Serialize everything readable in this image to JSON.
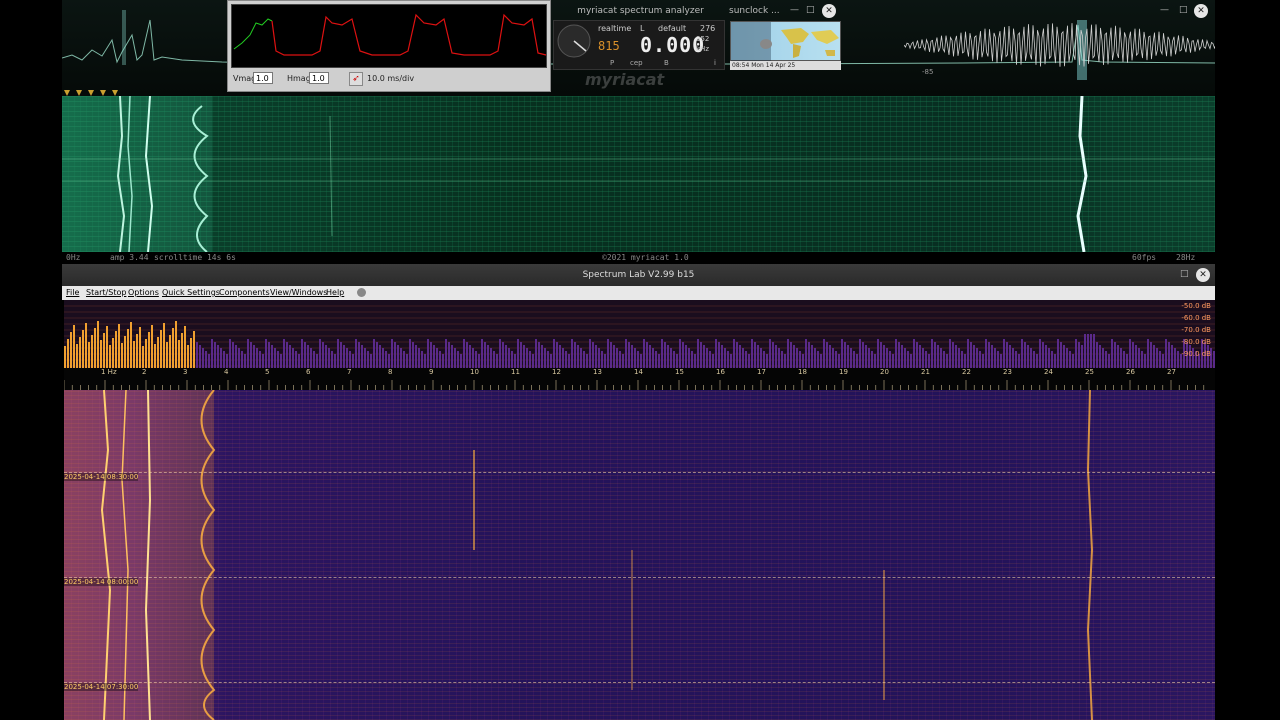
{
  "myriacat": {
    "title": "myriacat spectrum analyzer",
    "mode": "realtime",
    "channel": "L",
    "preset": "default",
    "value_a": "276",
    "value_b": "352",
    "frequency": "0.000",
    "unit": "kHz",
    "small_value": "815",
    "btn_p": "P",
    "btn_cep": "cep",
    "btn_b": "B",
    "btn_i": "i",
    "logo": "myriacat",
    "status_left": "0Hz",
    "status_amp": "amp 3.44",
    "status_scroll": "scrolltime 14s 6s",
    "status_copyright": "©2021 myriacat 1.0",
    "status_fps": "60fps",
    "status_right": "28Hz",
    "peak_label": "-85"
  },
  "scope": {
    "vmag_label": "Vmag",
    "vmag_value": "1.0",
    "hmag_label": "Hmag",
    "hmag_value": "1.0",
    "timebase": "10.0 ms/div"
  },
  "sunclock": {
    "title": "sunclock ...",
    "status": "08:54 Mon 14 Apr 25"
  },
  "spectrum_lab": {
    "title": "Spectrum Lab V2.99 b15",
    "menu": [
      "File",
      "Start/Stop",
      "Options",
      "Quick Settings",
      "Components",
      "View/Windows",
      "Help"
    ],
    "db_labels": [
      "-50.0 dB",
      "-60.0 dB",
      "-70.0 dB",
      "-80.0 dB",
      "-90.0 dB"
    ],
    "axis_labels": [
      "1 Hz",
      "2",
      "3",
      "4",
      "5",
      "6",
      "7",
      "8",
      "9",
      "10",
      "11",
      "12",
      "13",
      "14",
      "15",
      "16",
      "17",
      "18",
      "19",
      "20",
      "21",
      "22",
      "23",
      "24",
      "25",
      "26",
      "27"
    ],
    "timestamps": [
      "2025-04-14 08:30:00",
      "2025-04-14 08:00:00",
      "2025-04-14 07:30:00"
    ]
  },
  "colors": {
    "top_waterfall": "#0a3f2b",
    "sl_waterfall": "#24135a",
    "sl_peak": "#ffb040",
    "scope_green": "#22cc22",
    "scope_red": "#dd1111"
  }
}
